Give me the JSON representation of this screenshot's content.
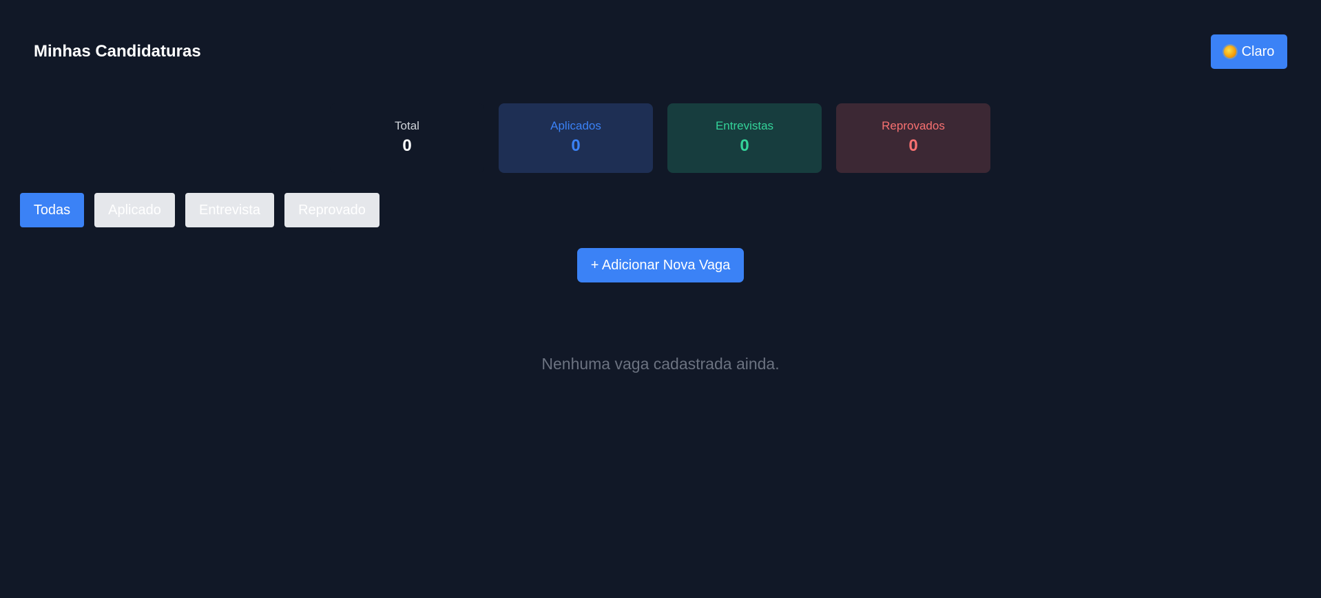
{
  "header": {
    "title": "Minhas Candidaturas",
    "theme_toggle": {
      "icon": "sun-icon",
      "label": "Claro"
    }
  },
  "stats": [
    {
      "label": "Total",
      "value": "0",
      "color": "#ffffff"
    },
    {
      "label": "Aplicados",
      "value": "0",
      "color": "#3b82f6"
    },
    {
      "label": "Entrevistas",
      "value": "0",
      "color": "#34d399"
    },
    {
      "label": "Reprovados",
      "value": "0",
      "color": "#f87171"
    }
  ],
  "filters": [
    {
      "label": "Todas",
      "active": true
    },
    {
      "label": "Aplicado",
      "active": false
    },
    {
      "label": "Entrevista",
      "active": false
    },
    {
      "label": "Reprovado",
      "active": false
    }
  ],
  "add_button": {
    "label": "+ Adicionar Nova Vaga"
  },
  "empty_state": {
    "message": "Nenhuma vaga cadastrada ainda."
  },
  "colors": {
    "background": "#111827",
    "accent": "#3b82f6",
    "muted_text": "#6b7280"
  }
}
